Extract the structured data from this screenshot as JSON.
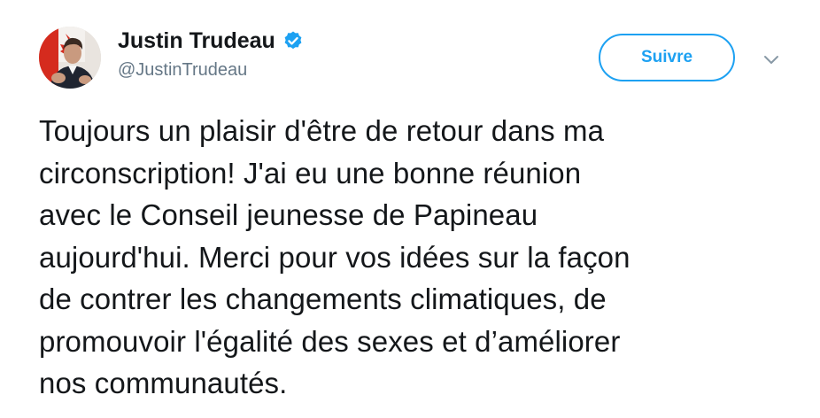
{
  "author": {
    "name": "Justin Trudeau",
    "handle": "@JustinTrudeau",
    "verified": true,
    "avatar_icon": "profile-photo"
  },
  "actions": {
    "follow_label": "Suivre",
    "menu_icon": "chevron-down-icon"
  },
  "tweet": {
    "lines": [
      "Toujours un plaisir d'être de retour dans ma",
      "circonscription! J'ai eu une bonne réunion",
      "avec le Conseil jeunesse de Papineau",
      "aujourd'hui. Merci pour vos idées sur la façon",
      "de contrer les changements climatiques, de",
      "promouvoir l'égalité des sexes et d’améliorer",
      "nos communautés."
    ]
  },
  "colors": {
    "accent": "#1da1f2",
    "text": "#14171a",
    "muted": "#657786"
  }
}
